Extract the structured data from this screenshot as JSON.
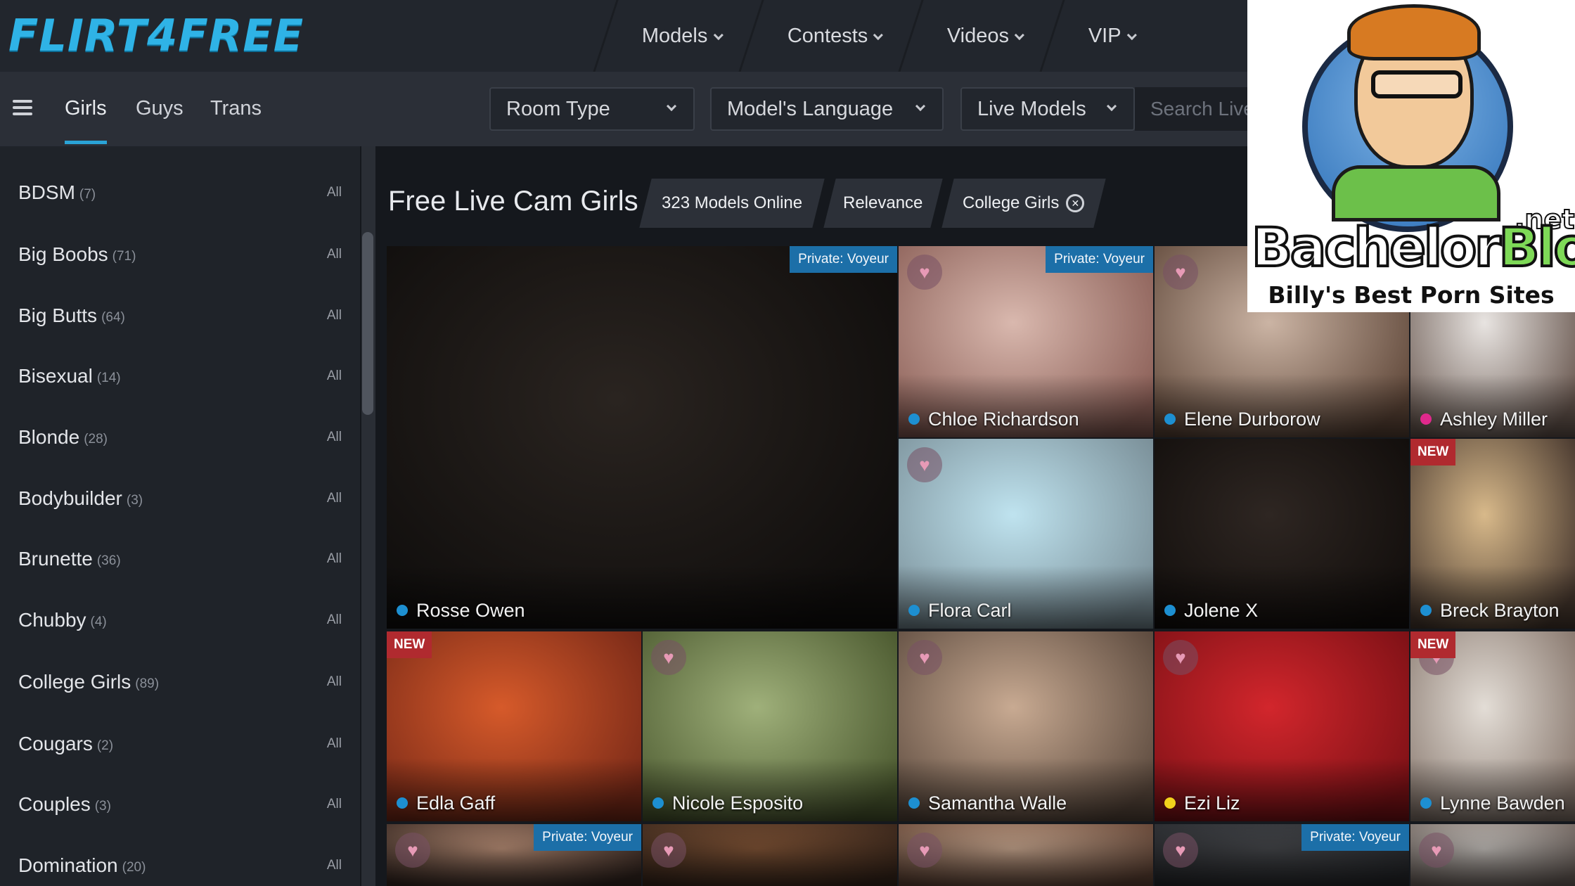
{
  "header": {
    "logo": "FLIRT4FREE",
    "nav": [
      "Models",
      "Contests",
      "Videos",
      "VIP"
    ]
  },
  "subnav": {
    "tabs": [
      "Girls",
      "Guys",
      "Trans"
    ],
    "active_tab": "Girls",
    "filters": [
      "Room Type",
      "Model's Language",
      "Live Models"
    ],
    "search_placeholder": "Search Live"
  },
  "sidebar": {
    "categories": [
      {
        "name": "BDSM",
        "count": "(7)",
        "all": "All"
      },
      {
        "name": "Big Boobs",
        "count": "(71)",
        "all": "All"
      },
      {
        "name": "Big Butts",
        "count": "(64)",
        "all": "All"
      },
      {
        "name": "Bisexual",
        "count": "(14)",
        "all": "All"
      },
      {
        "name": "Blonde",
        "count": "(28)",
        "all": "All"
      },
      {
        "name": "Bodybuilder",
        "count": "(3)",
        "all": "All"
      },
      {
        "name": "Brunette",
        "count": "(36)",
        "all": "All"
      },
      {
        "name": "Chubby",
        "count": "(4)",
        "all": "All"
      },
      {
        "name": "College Girls",
        "count": "(89)",
        "all": "All"
      },
      {
        "name": "Cougars",
        "count": "(2)",
        "all": "All"
      },
      {
        "name": "Couples",
        "count": "(3)",
        "all": "All"
      },
      {
        "name": "Domination",
        "count": "(20)",
        "all": "All"
      }
    ]
  },
  "main": {
    "title": "Free Live Cam Girls",
    "models_online": "323 Models Online",
    "sort": "Relevance",
    "active_filter": "College Girls"
  },
  "models": [
    {
      "name": "Rosse Owen",
      "status": "#1d8fd1",
      "badge": "Private: Voyeur",
      "new": false,
      "fav": false,
      "colors": [
        "#2a2420",
        "#0f0d0c"
      ]
    },
    {
      "name": "Chloe Richardson",
      "status": "#1d8fd1",
      "badge": "Private: Voyeur",
      "new": false,
      "fav": true,
      "colors": [
        "#d9b8ae",
        "#8a5e56"
      ]
    },
    {
      "name": "Elene Durborow",
      "status": "#1d8fd1",
      "badge": "",
      "new": false,
      "fav": true,
      "colors": [
        "#cbb4a4",
        "#5e4638"
      ]
    },
    {
      "name": "Ashley Miller",
      "status": "#e0298c",
      "badge": "",
      "new": false,
      "fav": false,
      "colors": [
        "#e8e4e1",
        "#6b5a52"
      ]
    },
    {
      "name": "Flora Carl",
      "status": "#1d8fd1",
      "badge": "",
      "new": false,
      "fav": true,
      "colors": [
        "#bfe3ef",
        "#7a8f98"
      ]
    },
    {
      "name": "Jolene X",
      "status": "#1d8fd1",
      "badge": "",
      "new": false,
      "fav": false,
      "colors": [
        "#2e2622",
        "#120e0c"
      ]
    },
    {
      "name": "Breck Brayton",
      "status": "#1d8fd1",
      "badge": "",
      "new": true,
      "fav": false,
      "colors": [
        "#d8b98a",
        "#4a3a30"
      ]
    },
    {
      "name": "Edla Gaff",
      "status": "#1d8fd1",
      "badge": "",
      "new": true,
      "fav": false,
      "colors": [
        "#d65a2a",
        "#7a2a18"
      ]
    },
    {
      "name": "Nicole Esposito",
      "status": "#1d8fd1",
      "badge": "",
      "new": false,
      "fav": true,
      "colors": [
        "#9fb07a",
        "#4c5a30"
      ]
    },
    {
      "name": "Samantha Walle",
      "status": "#1d8fd1",
      "badge": "",
      "new": false,
      "fav": true,
      "colors": [
        "#c8aa92",
        "#5c4a3e"
      ]
    },
    {
      "name": "Ezi Liz",
      "status": "#f1d21c",
      "badge": "",
      "new": false,
      "fav": true,
      "colors": [
        "#d2262c",
        "#7e1116"
      ]
    },
    {
      "name": "Lynne Bawden",
      "status": "#1d8fd1",
      "badge": "",
      "new": true,
      "fav": true,
      "colors": [
        "#e3ddd6",
        "#8a7a70"
      ]
    },
    {
      "name": "",
      "status": "",
      "badge": "Private: Voyeur",
      "new": false,
      "fav": true,
      "colors": [
        "#c89a80",
        "#3a2a24"
      ]
    },
    {
      "name": "",
      "status": "",
      "badge": "",
      "new": false,
      "fav": true,
      "colors": [
        "#8a5a3a",
        "#3e2a1e"
      ]
    },
    {
      "name": "",
      "status": "",
      "badge": "",
      "new": false,
      "fav": true,
      "colors": [
        "#d8b49a",
        "#6a4a3a"
      ]
    },
    {
      "name": "",
      "status": "",
      "badge": "Private: Voyeur",
      "new": false,
      "fav": true,
      "colors": [
        "#4a4c50",
        "#2a2c30"
      ]
    },
    {
      "name": "",
      "status": "",
      "badge": "",
      "new": false,
      "fav": true,
      "colors": [
        "#d4cfca",
        "#7a6e68"
      ]
    }
  ],
  "overlay": {
    "brand_1": "Bachelor",
    "brand_2": "Blog",
    "brand_net": ".net",
    "tagline": "Billy's Best Porn Sites"
  },
  "colors": {
    "accent": "#2aa3d6",
    "topbar": "#22262d",
    "sidebar": "#1f2329"
  }
}
